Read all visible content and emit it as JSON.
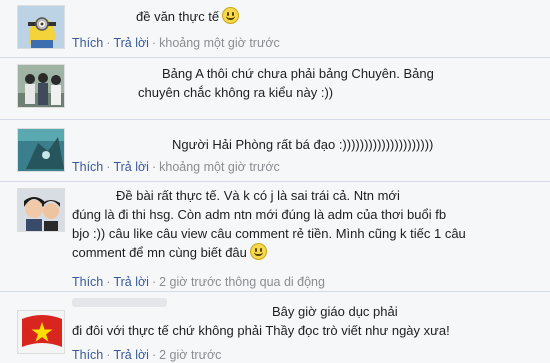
{
  "comments": [
    {
      "text_lines": [
        "đề văn thực tế"
      ],
      "emoji": "smiley-emoji",
      "actions": {
        "like": "Thích",
        "reply": "Trả lời",
        "time": "khoảng một giờ trước"
      }
    },
    {
      "text_lines": [
        "Bảng A thôi chứ chưa phải bảng Chuyên. Bảng",
        "chuyên chắc không ra kiểu này :))"
      ],
      "actions": {
        "like": "Thích",
        "reply": "Trả lời",
        "time": "khoảng một giờ trước"
      }
    },
    {
      "text_lines": [
        "Người Hải Phòng rất bá đạo :)))))))))))))))))))))"
      ],
      "actions": {
        "like": "Thích",
        "reply": "Trả lời",
        "time": "khoảng một giờ trước"
      }
    },
    {
      "text_lines": [
        "Đề bài rất thực tế. Và k có j là sai trái cả. Ntn mới",
        "đúng là đi thi hsg. Còn adm ntn mới đúng là adm của thơi buổi fb",
        "bjo :)) câu like câu view câu comment rẻ tiền. Mình cũng k tiếc 1 câu",
        "comment để mn cùng biết đâu"
      ],
      "emoji": "smiley-emoji",
      "actions": {
        "like": "Thích",
        "reply": "Trả lời",
        "time": "2 giờ trước thông qua di động"
      }
    },
    {
      "text_lines": [
        "Bây giờ giáo dục phải",
        "đi đôi với thực tế chứ không phải Thầy đọc trò viết như ngày xưa!"
      ],
      "actions": {
        "like": "Thích",
        "reply": "Trả lời",
        "time": "2 giờ trước"
      }
    }
  ],
  "separator": "·"
}
